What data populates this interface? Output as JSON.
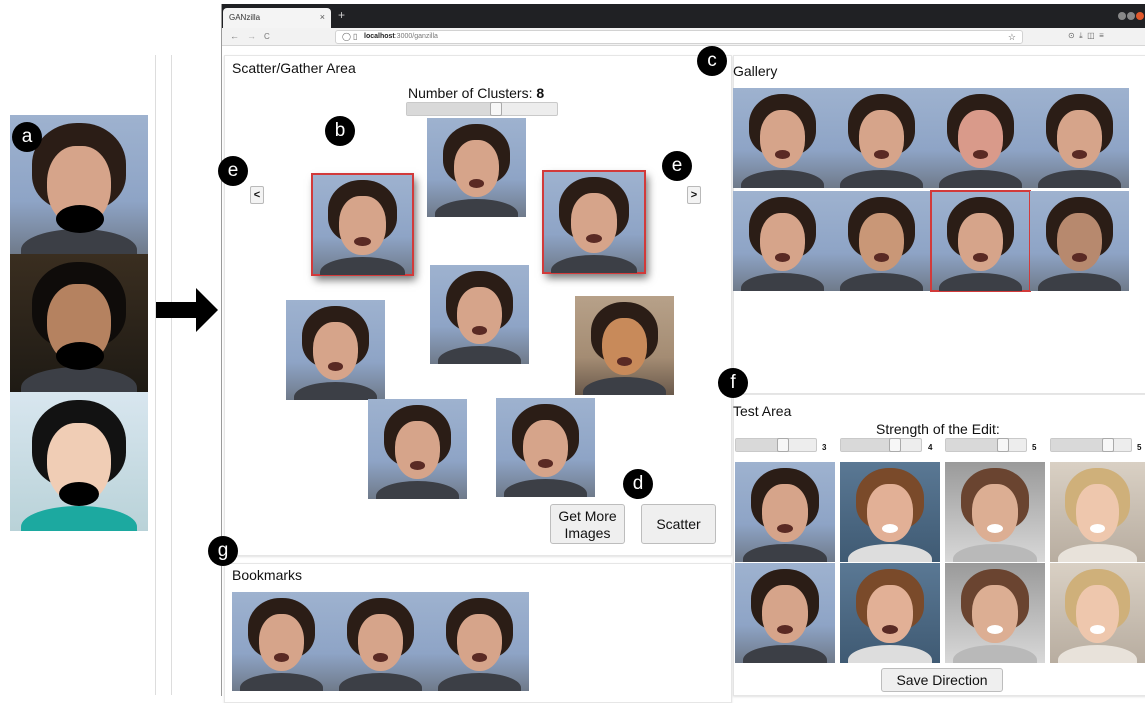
{
  "markers": {
    "a": "a",
    "b": "b",
    "c": "c",
    "d": "d",
    "e_left": "e",
    "e_right": "e",
    "f": "f",
    "g": "g"
  },
  "browser": {
    "tab_title": "GANzilla",
    "tab_close": "×",
    "new_tab": "+",
    "url_host": "localhost",
    "url_path": ":3000/ganzilla",
    "nav": {
      "back": "←",
      "forward": "→",
      "reload": "C"
    },
    "bookmark_star": "☆",
    "extensions": "⊙  ⤓  ◫  ≡"
  },
  "scatter_area": {
    "title": "Scatter/Gather Area",
    "clusters_label": "Number of Clusters:",
    "clusters_value": "8",
    "clusters_level": 0.6,
    "prev_button": "<",
    "next_button": ">",
    "get_more_button_line1": "Get More",
    "get_more_button_line2": "Images",
    "scatter_button": "Scatter"
  },
  "gallery": {
    "title": "Gallery"
  },
  "test_area": {
    "title": "Test Area",
    "strength_label": "Strength of the Edit:",
    "sliders": [
      {
        "value": "3",
        "level": 0.6
      },
      {
        "value": "4",
        "level": 0.7
      },
      {
        "value": "5",
        "level": 0.75
      },
      {
        "value": "5",
        "level": 0.75
      }
    ],
    "save_button": "Save Direction"
  },
  "bookmarks": {
    "title": "Bookmarks"
  },
  "icons": {
    "arrow": "right-arrow-icon",
    "lock": "shield-icon",
    "page": "page-icon"
  }
}
